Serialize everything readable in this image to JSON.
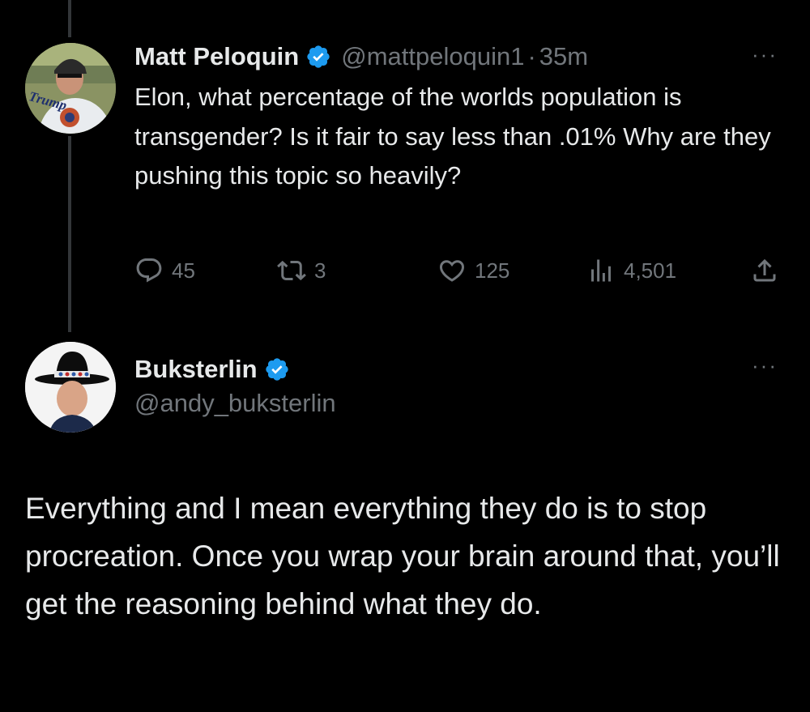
{
  "tweet1": {
    "author_name": "Matt Peloquin",
    "handle": "@mattpeloquin1",
    "separator": "·",
    "time": "35m",
    "more_label": "···",
    "avatar_cap_text": "Trump",
    "text": "Elon, what percentage of the worlds population is transgender? Is it fair to say less than .01% Why are they pushing this topic so heavily?",
    "replies": "45",
    "retweets": "3",
    "likes": "125",
    "views": "4,501"
  },
  "tweet2": {
    "author_name": "Buksterlin",
    "handle": "@andy_buksterlin",
    "more_label": "···",
    "text": "Everything and I mean everything they do is to stop procreation. Once you wrap your brain around that, you’ll get the reasoning behind what they do."
  },
  "colors": {
    "background": "#000000",
    "primary_text": "#e7e9ea",
    "secondary_text": "#71767b",
    "verified_badge": "#1d9bf0",
    "thread_line": "#333639"
  }
}
